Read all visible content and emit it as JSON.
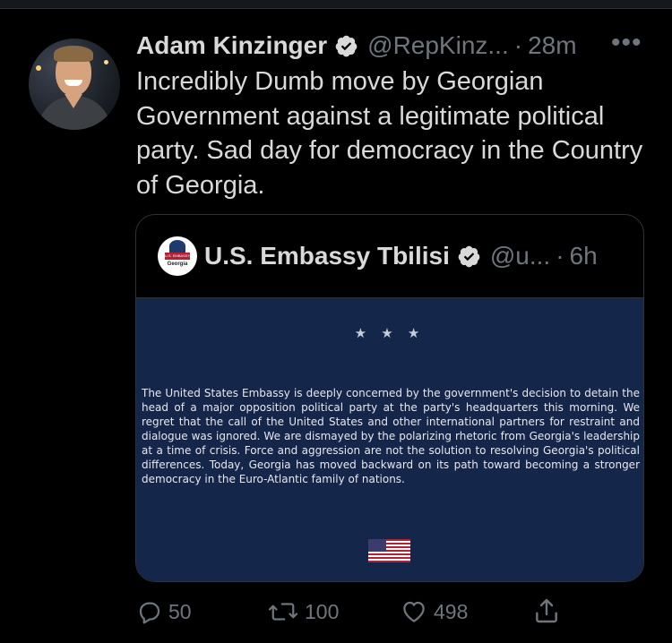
{
  "tweet": {
    "author_name": "Adam Kinzinger",
    "handle": "@RepKinz...",
    "separator": "·",
    "time": "28m",
    "more": "•••",
    "text": "Incredibly Dumb move by Georgian Government against a legitimate political party.  Sad day for democracy in the Country of Georgia."
  },
  "quoted_tweet": {
    "author_name": "U.S. Embassy Tbilisi",
    "handle": "@u...",
    "separator": "·",
    "time": "6h",
    "avatar_band_text": "U.S. EMBASSY",
    "avatar_country": "Georgia",
    "image": {
      "stars": "★ ★ ★",
      "statement": "The United States Embassy is deeply concerned by the government's decision to detain the head of a major opposition political party at the party's headquarters this morning.  We regret that the call of the United States and other international partners for restraint and dialogue was ignored.   We are dismayed by the polarizing rhetoric from Georgia's leadership at a time of crisis.  Force and aggression are not the solution to resolving Georgia's political differences.  Today, Georgia has moved backward on its path toward becoming a stronger democracy in the Euro-Atlantic family of nations."
    }
  },
  "actions": {
    "replies": "50",
    "retweets": "100",
    "likes": "498"
  },
  "icons": {
    "verified": "verified-badge-icon",
    "reply": "reply-icon",
    "retweet": "retweet-icon",
    "like": "heart-icon",
    "share": "share-icon"
  },
  "colors": {
    "background": "#000000",
    "text": "#d9d9d9",
    "muted": "#6e767d",
    "embassy_blue": "#14264a"
  }
}
